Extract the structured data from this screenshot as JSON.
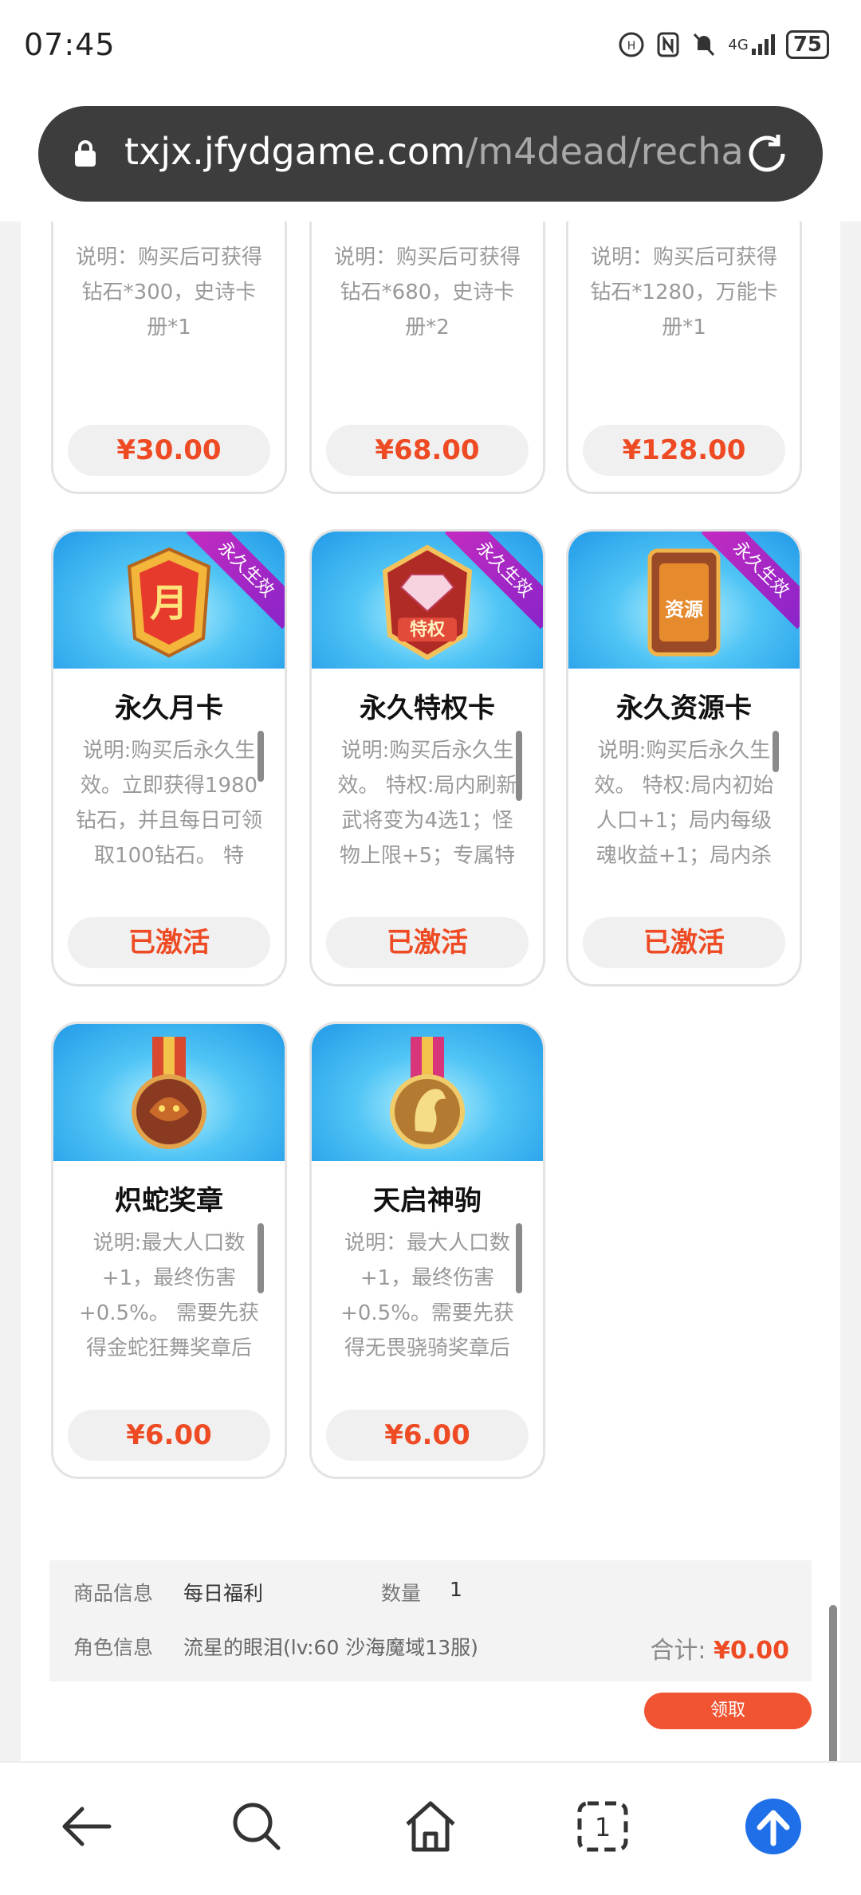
{
  "status_bar": {
    "time": "07:45",
    "network": "4G",
    "battery": "75"
  },
  "browser": {
    "url_host": "txjx.jfydgame.com",
    "url_path": "/m4dead/recha"
  },
  "cards_row1": [
    {
      "desc": "说明：购买后可获得钻石*300，史诗卡册*1",
      "price": "¥30.00"
    },
    {
      "desc": "说明：购买后可获得钻石*680，史诗卡册*2",
      "price": "¥68.00"
    },
    {
      "desc": "说明：购买后可获得钻石*1280，万能卡册*1",
      "price": "¥128.00"
    }
  ],
  "cards_row2": [
    {
      "ribbon": "永久生效",
      "title": "永久月卡",
      "desc": "说明:购买后永久生效。立即获得1980钻石，并且每日可领取100钻石。 特",
      "button": "已激活",
      "icon": "month-card-icon"
    },
    {
      "ribbon": "永久生效",
      "title": "永久特权卡",
      "desc": "说明:购买后永久生效。 特权:局内刷新武将变为4选1；怪物上限+5；专属特",
      "button": "已激活",
      "icon": "privilege-card-icon"
    },
    {
      "ribbon": "永久生效",
      "title": "永久资源卡",
      "desc": "说明:购买后永久生效。 特权:局内初始人口+1；局内每级魂收益+1；局内杀",
      "button": "已激活",
      "icon": "resource-card-icon"
    }
  ],
  "cards_row3": [
    {
      "title": "炽蛇奖章",
      "desc": "说明:最大人口数+1，最终伤害+0.5%。 需要先获得金蛇狂舞奖章后",
      "price": "¥6.00",
      "icon": "snake-medal-icon"
    },
    {
      "title": "天启神驹",
      "desc": "说明：最大人口数+1，最终伤害+0.5%。需要先获得无畏骁骑奖章后",
      "price": "¥6.00",
      "icon": "horse-medal-icon"
    }
  ],
  "order": {
    "product_label": "商品信息",
    "product_value": "每日福利",
    "qty_label": "数量",
    "qty_value": "1",
    "role_label": "角色信息",
    "role_value": "流星的眼泪(lv:60 沙海魔域13服)",
    "total_label": "合计:",
    "total_value": "¥0.00",
    "receive_button": "领取"
  },
  "colors": {
    "accent": "#ee4b24",
    "url_bar": "#3d3d3d",
    "nav_blue": "#1f6fe8"
  }
}
